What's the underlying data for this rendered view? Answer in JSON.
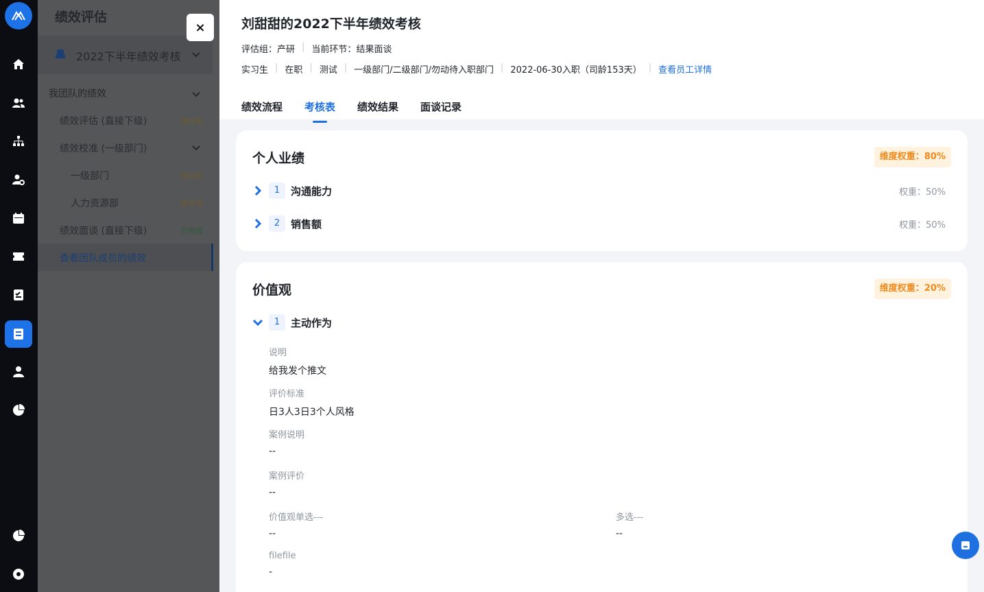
{
  "sidenav": {
    "title": "绩效评估",
    "plan": "2022下半年绩效考核",
    "group": "我团队的绩效",
    "items": [
      {
        "label": "绩效评估 (直接下级)",
        "status": "待完成"
      },
      {
        "label": "绩效校准 (一级部门)",
        "status": ""
      },
      {
        "label": "一级部门",
        "status": "待完成"
      },
      {
        "label": "人力资源部",
        "status": "待完成"
      },
      {
        "label": "绩效面谈 (直接下级)",
        "status": "已完成"
      },
      {
        "label": "查看团队成员的绩效",
        "status": ""
      }
    ]
  },
  "close_label": "×",
  "header": {
    "title": "刘甜甜的2022下半年绩效考核",
    "group_label": "评估组：",
    "group_value": "产研",
    "stage_label": "当前环节：",
    "stage_value": "结果面谈",
    "info": [
      "实习生",
      "在职",
      "测试",
      "一级部门/二级部门/勿动待入职部门",
      "2022-06-30入职（司龄153天）"
    ],
    "detail_link": "查看员工详情"
  },
  "tabs": [
    "绩效流程",
    "考核表",
    "绩效结果",
    "面谈记录"
  ],
  "card1": {
    "title": "个人业绩",
    "dim_weight": "维度权重：80%",
    "rows": [
      {
        "num": "1",
        "name": "沟通能力",
        "weight": "权重：50%"
      },
      {
        "num": "2",
        "name": "销售额",
        "weight": "权重：50%"
      }
    ]
  },
  "card2": {
    "title": "价值观",
    "dim_weight": "维度权重：20%",
    "rows": [
      {
        "num": "1",
        "name": "主动作为"
      }
    ],
    "fields": [
      {
        "label": "说明",
        "value": "给我发个推文"
      },
      {
        "label": "评价标准",
        "value": "日3人3日3个人风格"
      },
      {
        "label": "案例说明",
        "value": "--"
      },
      {
        "label": "案例评价",
        "value": "--"
      },
      {
        "label": "价值观单选---",
        "value": "--"
      },
      {
        "label": "多选---",
        "value": "--"
      },
      {
        "label": "filefile",
        "value": "-"
      }
    ]
  },
  "colors": {
    "accent": "#1e6fe0",
    "warning": "#f08a1a",
    "rail": "#0b0d12"
  },
  "rail_icons": [
    "home-icon",
    "people-icon",
    "org-chart-icon",
    "user-settings-icon",
    "calendar-icon",
    "ticket-icon",
    "checklist-icon",
    "performance-icon",
    "person-icon",
    "pie-chart-icon",
    "stats-icon",
    "settings-icon"
  ],
  "fab_icon": "chat-icon"
}
